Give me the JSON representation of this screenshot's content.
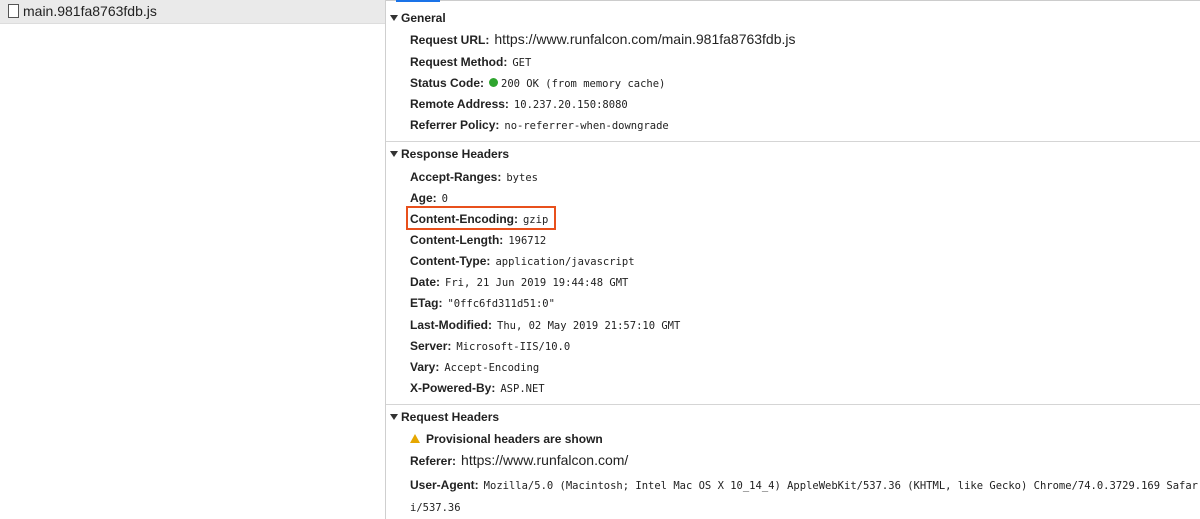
{
  "file_list": {
    "selected_file": "main.981fa8763fdb.js"
  },
  "general": {
    "title": "General",
    "request_url_label": "Request URL:",
    "request_url": "https://www.runfalcon.com/main.981fa8763fdb.js",
    "request_method_label": "Request Method:",
    "request_method": "GET",
    "status_code_label": "Status Code:",
    "status_code": "200 OK (from memory cache)",
    "status_color": "#2fa52f",
    "remote_address_label": "Remote Address:",
    "remote_address": "10.237.20.150:8080",
    "referrer_policy_label": "Referrer Policy:",
    "referrer_policy": "no-referrer-when-downgrade"
  },
  "response_headers": {
    "title": "Response Headers",
    "items": [
      {
        "key": "Accept-Ranges:",
        "value": "bytes"
      },
      {
        "key": "Age:",
        "value": "0"
      },
      {
        "key": "Content-Encoding:",
        "value": "gzip"
      },
      {
        "key": "Content-Length:",
        "value": "196712"
      },
      {
        "key": "Content-Type:",
        "value": "application/javascript"
      },
      {
        "key": "Date:",
        "value": "Fri, 21 Jun 2019 19:44:48 GMT"
      },
      {
        "key": "ETag:",
        "value": "\"0ffc6fd311d51:0\""
      },
      {
        "key": "Last-Modified:",
        "value": "Thu, 02 May 2019 21:57:10 GMT"
      },
      {
        "key": "Server:",
        "value": "Microsoft-IIS/10.0"
      },
      {
        "key": "Vary:",
        "value": "Accept-Encoding"
      },
      {
        "key": "X-Powered-By:",
        "value": "ASP.NET"
      }
    ],
    "highlight_color": "#e8501c"
  },
  "request_headers": {
    "title": "Request Headers",
    "warning": "Provisional headers are shown",
    "warning_color": "#e6a700",
    "referer_label": "Referer:",
    "referer": "https://www.runfalcon.com/",
    "user_agent_label": "User-Agent:",
    "user_agent": "Mozilla/5.0 (Macintosh; Intel Mac OS X 10_14_4) AppleWebKit/537.36 (KHTML, like Gecko) Chrome/74.0.3729.169 Safari/537.36"
  }
}
